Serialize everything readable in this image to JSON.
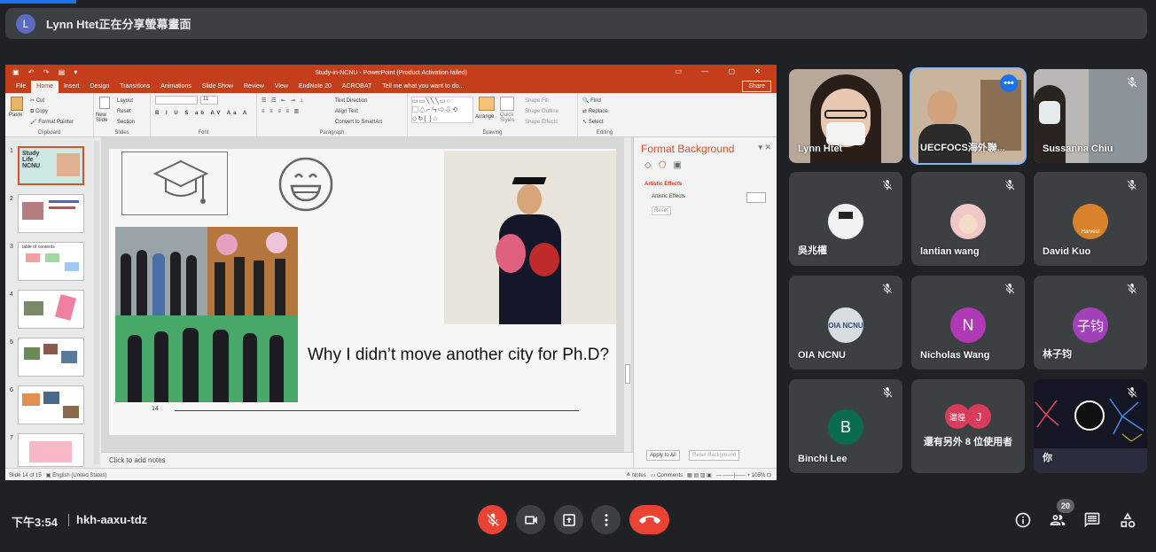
{
  "share_banner": {
    "avatar_letter": "L",
    "text": "Lynn Htet正在分享螢幕畫面"
  },
  "ppt": {
    "window_title": "Study-in-NCNU - PowerPoint (Product Activation failed)",
    "tabs": [
      "File",
      "Home",
      "Insert",
      "Design",
      "Transitions",
      "Animations",
      "Slide Show",
      "Review",
      "View",
      "EndNote 20",
      "ACROBAT",
      "Tell me what you want to do..."
    ],
    "share_label": "Share",
    "ribbon": {
      "clipboard": {
        "paste": "Paste",
        "cut": "Cut",
        "copy": "Copy",
        "format_painter": "Format Painter",
        "label": "Clipboard"
      },
      "slides": {
        "new_slide": "New Slide",
        "layout": "Layout",
        "reset": "Reset",
        "section": "Section",
        "label": "Slides"
      },
      "font": {
        "size": "11",
        "label": "Font"
      },
      "paragraph": {
        "text_direction": "Text Direction",
        "align_text": "Align Text",
        "smartart": "Convert to SmartArt",
        "label": "Paragraph"
      },
      "drawing": {
        "arrange": "Arrange",
        "quick_styles": "Quick Styles",
        "shape_fill": "Shape Fill",
        "shape_outline": "Shape Outline",
        "shape_effects": "Shape Effects",
        "label": "Drawing"
      },
      "editing": {
        "find": "Find",
        "replace": "Replace",
        "select": "Select",
        "label": "Editing"
      }
    },
    "thumbnails": [
      "1",
      "2",
      "3",
      "4",
      "5",
      "6",
      "7"
    ],
    "thumb_texts": {
      "t1": "Study Life NCNU",
      "t3": "table of contents"
    },
    "slide": {
      "caption": "Why I didn’t move another city for Ph.D?",
      "number": "14"
    },
    "notes_placeholder": "Click to add notes",
    "format_pane": {
      "title": "Format Background",
      "section": "Artistic Effects",
      "field_label": "Artistic Effects",
      "reset": "Reset",
      "apply_all": "Apply to All",
      "reset_background": "Reset Background"
    },
    "status": {
      "slide_info": "Slide 14 of 15",
      "language": "English (United States)",
      "notes": "Notes",
      "comments": "Comments",
      "zoom": "105%"
    }
  },
  "participants": [
    {
      "name": "Lynn Htet",
      "type": "video"
    },
    {
      "name": "UECFOCS海外聯...",
      "type": "video"
    },
    {
      "name": "Sussanna Chiu",
      "type": "video"
    },
    {
      "name": "吳兆權",
      "type": "avatar"
    },
    {
      "name": "lantian wang",
      "type": "avatar"
    },
    {
      "name": "David Kuo",
      "type": "avatar"
    },
    {
      "name": "OIA NCNU",
      "type": "avatar",
      "avatar_text": "OIA NCNU"
    },
    {
      "name": "Nicholas Wang",
      "type": "letter",
      "letter": "N"
    },
    {
      "name": "林子钧",
      "type": "letter",
      "letter": "子钧"
    },
    {
      "name": "Binchi Lee",
      "type": "letter",
      "letter": "B"
    },
    {
      "name": "還有另外 8 位使用者",
      "type": "overflow",
      "letters": [
        "邋徨",
        "J"
      ]
    },
    {
      "name": "你",
      "type": "self"
    }
  ],
  "avatar_labels": {
    "david": "Harvest"
  },
  "bottom_bar": {
    "time": "下午3:54",
    "meeting_code": "hkh-aaxu-tdz",
    "people_count": "20"
  },
  "icons": [
    "mic-off-icon",
    "camera-icon",
    "present-icon",
    "more-icon",
    "end-call-icon",
    "info-icon",
    "people-icon",
    "chat-icon",
    "activities-icon"
  ],
  "colors": {
    "meet_bg": "#202124",
    "tile_bg": "#3c4043",
    "ppt_red": "#c43e1c",
    "end_call_red": "#ea4335",
    "active_border": "#8ab4f8"
  }
}
